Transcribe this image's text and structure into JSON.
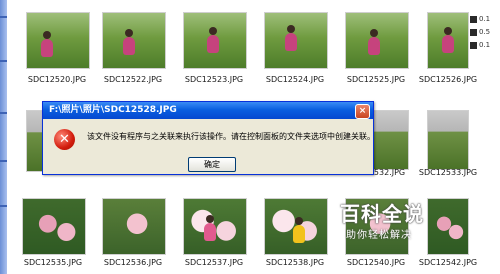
{
  "dialog": {
    "title": "F:\\照片\\照片\\SDC12528.JPG",
    "message": "该文件没有程序与之关联来执行该操作。请在控制面板的文件夹选项中创建关联。",
    "ok_label": "确定",
    "close_glyph": "×",
    "error_glyph": "✕"
  },
  "files": {
    "row1": [
      "SDC12520.JPG",
      "SDC12522.JPG",
      "SDC12523.JPG",
      "SDC12524.JPG",
      "SDC12525.JPG",
      "SDC12526.JPG"
    ],
    "row2_right": "SDC12533.JPG",
    "row3": [
      "SDC12535.JPG",
      "SDC12536.JPG",
      "SDC12537.JPG",
      "SDC12538.JPG",
      "SDC12540.JPG",
      "SDC12542.JPG"
    ],
    "row2_partial": "SDC12532.JPG"
  },
  "right_panel": {
    "rows": [
      "0.1",
      "0.5",
      "0.1"
    ]
  },
  "watermark": {
    "title": "百科全说",
    "subtitle": "助你轻松解决"
  },
  "colors": {
    "title_bar": "#0a5fe0",
    "dialog_bg": "#ece9d8",
    "error_red": "#d21c0c"
  }
}
